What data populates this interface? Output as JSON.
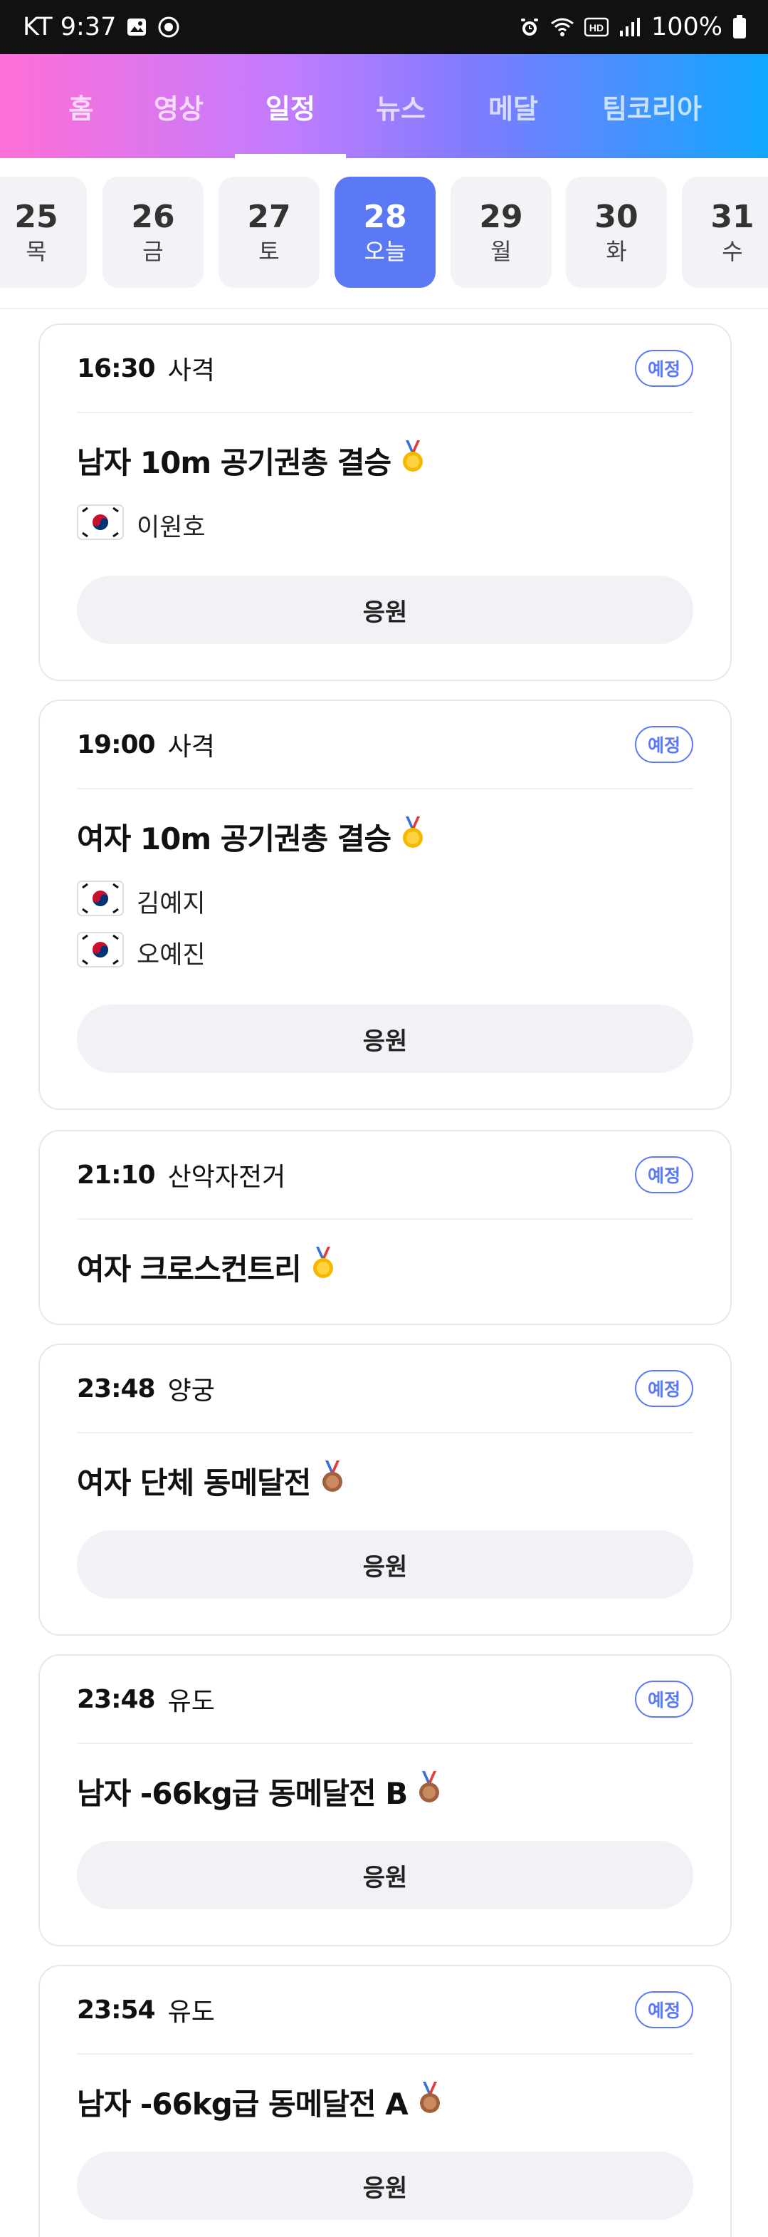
{
  "status_bar": {
    "carrier_time": "KT 9:37",
    "battery": "100%",
    "icons": [
      "image-icon",
      "record-icon",
      "alarm-icon",
      "wifi-icon",
      "hd-icon",
      "signal-icon",
      "battery-icon"
    ]
  },
  "nav": {
    "tabs": [
      {
        "label": "홈",
        "active": false
      },
      {
        "label": "영상",
        "active": false
      },
      {
        "label": "일정",
        "active": true
      },
      {
        "label": "뉴스",
        "active": false
      },
      {
        "label": "메달",
        "active": false
      },
      {
        "label": "팀코리아",
        "active": false
      }
    ],
    "gradient_colors": [
      "#ff6fd8",
      "#c07cff",
      "#7e7bff",
      "#10a7ff"
    ]
  },
  "dates": [
    {
      "num": "25",
      "dow": "목",
      "active": false
    },
    {
      "num": "26",
      "dow": "금",
      "active": false
    },
    {
      "num": "27",
      "dow": "토",
      "active": false
    },
    {
      "num": "28",
      "dow": "오늘",
      "active": true
    },
    {
      "num": "29",
      "dow": "월",
      "active": false
    },
    {
      "num": "30",
      "dow": "화",
      "active": false
    },
    {
      "num": "31",
      "dow": "수",
      "active": false
    }
  ],
  "accent_color": "#5b79f5",
  "events": [
    {
      "time": "16:30",
      "sport": "사격",
      "status": "예정",
      "title": "남자 10m 공기권총 결승",
      "medal": "gold-medal-icon",
      "athletes": [
        "이원호"
      ],
      "cheer": "응원"
    },
    {
      "time": "19:00",
      "sport": "사격",
      "status": "예정",
      "title": "여자 10m 공기권총 결승",
      "medal": "gold-medal-icon",
      "athletes": [
        "김예지",
        "오예진"
      ],
      "cheer": "응원"
    },
    {
      "time": "21:10",
      "sport": "산악자전거",
      "status": "예정",
      "title": "여자 크로스컨트리",
      "medal": "gold-medal-icon",
      "athletes": [],
      "cheer": null
    },
    {
      "time": "23:48",
      "sport": "양궁",
      "status": "예정",
      "title": "여자 단체 동메달전",
      "medal": "bronze-medal-icon",
      "athletes": [],
      "cheer": "응원"
    },
    {
      "time": "23:48",
      "sport": "유도",
      "status": "예정",
      "title": "남자 -66kg급 동메달전 B",
      "medal": "bronze-medal-icon",
      "athletes": [],
      "cheer": "응원"
    },
    {
      "time": "23:54",
      "sport": "유도",
      "status": "예정",
      "title": "남자 -66kg급 동메달전 A",
      "medal": "bronze-medal-icon",
      "athletes": [],
      "cheer": "응원"
    }
  ]
}
